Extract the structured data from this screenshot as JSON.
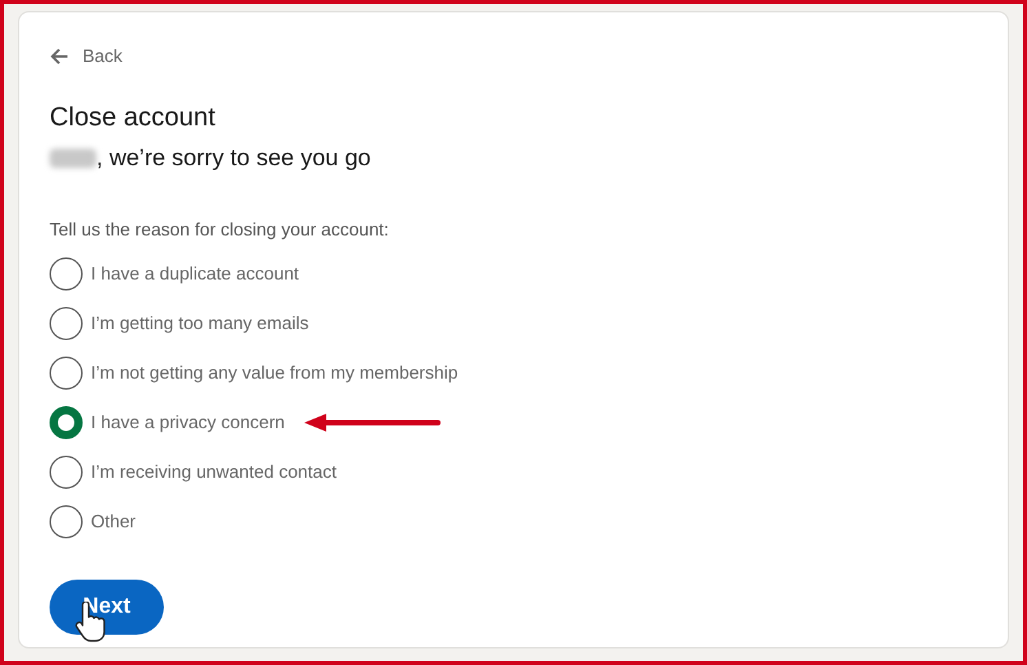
{
  "back_link": {
    "label": "Back"
  },
  "title": "Close account",
  "subtitle": ", we’re sorry to see you go",
  "prompt": "Tell us the reason for closing your account:",
  "reasons": [
    {
      "label": "I have a duplicate account",
      "selected": false
    },
    {
      "label": "I’m getting too many emails",
      "selected": false
    },
    {
      "label": "I’m not getting any value from my membership",
      "selected": false
    },
    {
      "label": "I have a privacy concern",
      "selected": true
    },
    {
      "label": "I’m receiving unwanted contact",
      "selected": false
    },
    {
      "label": "Other",
      "selected": false
    }
  ],
  "next_button": {
    "label": "Next"
  }
}
